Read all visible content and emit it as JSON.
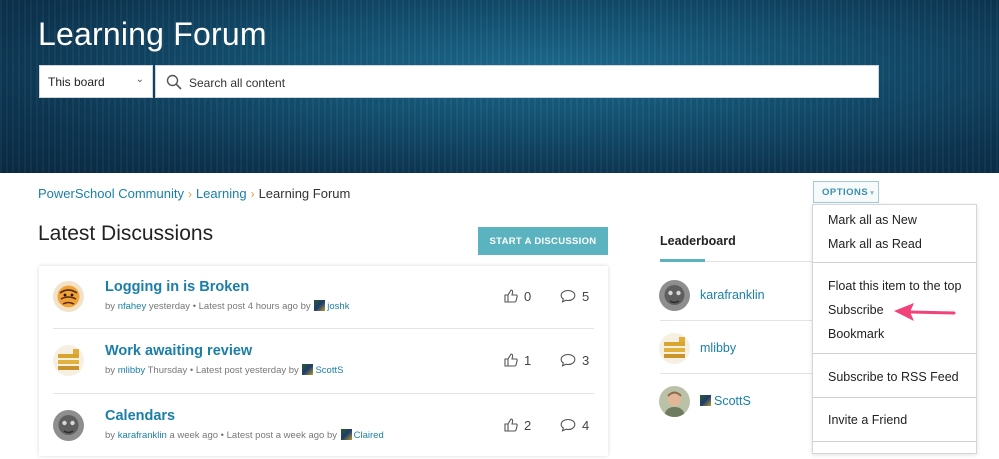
{
  "header": {
    "title": "Learning Forum",
    "board_select": "This board",
    "search_placeholder": "Search all content"
  },
  "breadcrumb": [
    "PowerSchool Community",
    "Learning",
    "Learning Forum"
  ],
  "options": {
    "label": "OPTIONS",
    "menu": {
      "group1": [
        "Mark all as New",
        "Mark all as Read"
      ],
      "group2": [
        "Float this item to the top",
        "Subscribe",
        "Bookmark"
      ],
      "group3": [
        "Subscribe to RSS Feed"
      ],
      "group4": [
        "Invite a Friend"
      ]
    }
  },
  "discussions": {
    "title": "Latest Discussions",
    "start_button": "START A DISCUSSION",
    "items": [
      {
        "title": "Logging in is Broken",
        "by": "by",
        "author": "nfahey",
        "when": "yesterday",
        "latest": "• Latest post 4 hours ago by",
        "last_user": "joshk",
        "likes": "0",
        "comments": "5"
      },
      {
        "title": "Work awaiting review",
        "by": "by",
        "author": "mlibby",
        "when": "Thursday",
        "latest": "• Latest post yesterday by",
        "last_user": "ScottS",
        "likes": "1",
        "comments": "3"
      },
      {
        "title": "Calendars",
        "by": "by",
        "author": "karafranklin",
        "when": "a week ago",
        "latest": "• Latest post a week ago by",
        "last_user": "Claired",
        "likes": "2",
        "comments": "4"
      }
    ]
  },
  "leaderboard": {
    "title": "Leaderboard",
    "users": [
      "karafranklin",
      "mlibby",
      "ScottS"
    ]
  },
  "colors": {
    "link": "#1a7fa8",
    "accent": "#5bb3bf",
    "arrow": "#f2427a"
  }
}
